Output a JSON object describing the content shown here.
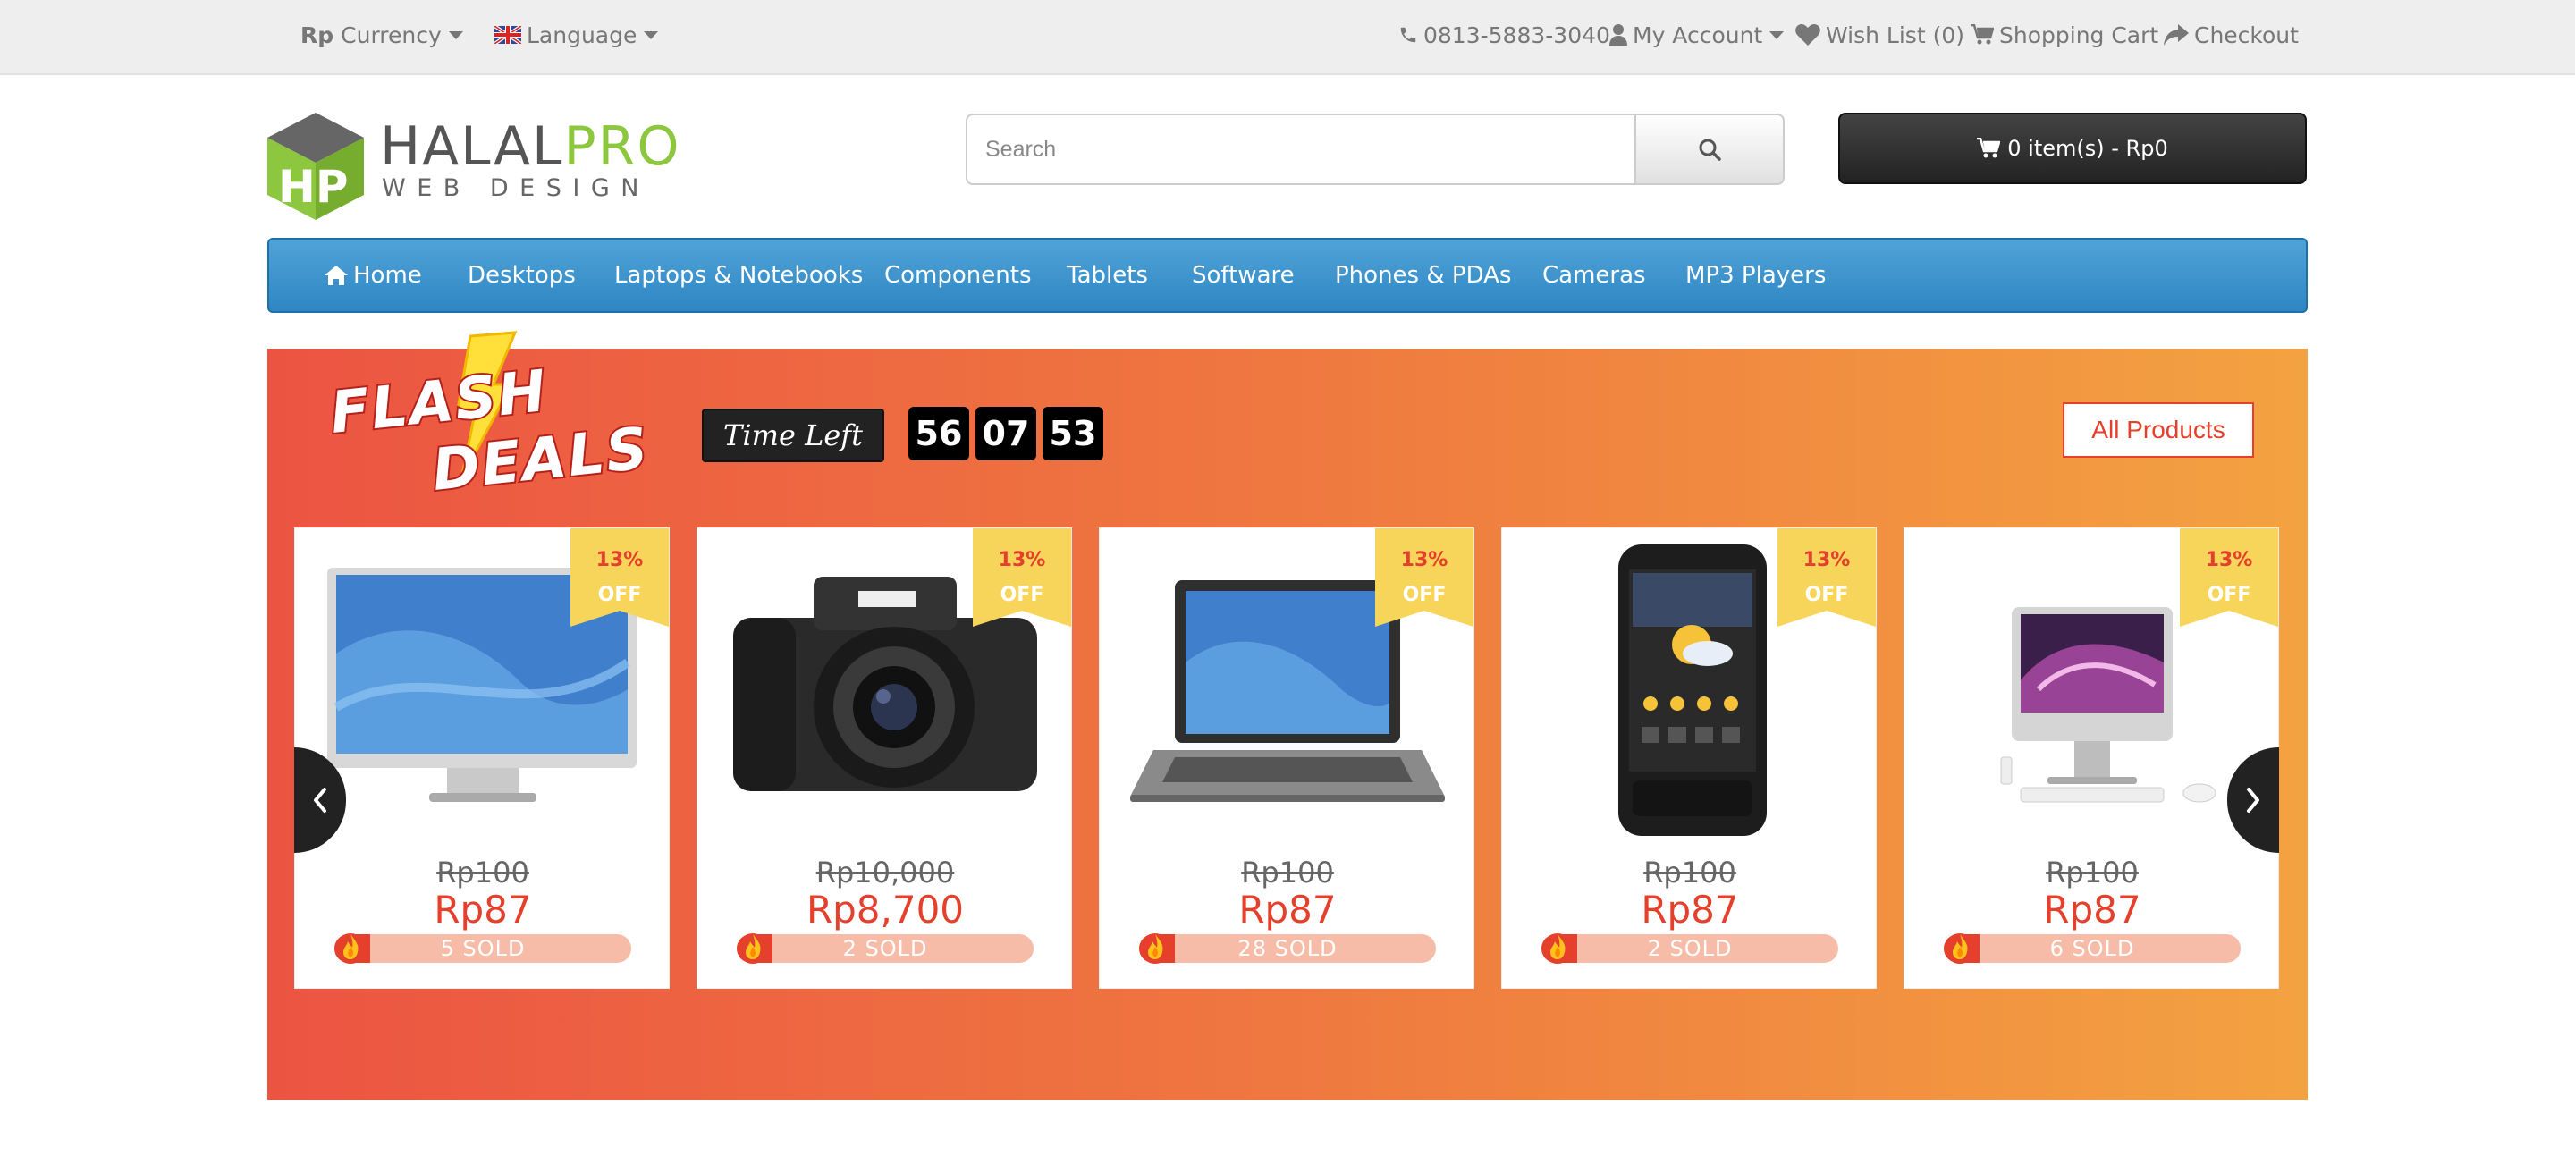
{
  "topbar": {
    "currency_symbol": "Rp",
    "currency_label": "Currency",
    "language_label": "Language",
    "phone": "0813-5883-3040",
    "account": "My Account",
    "wishlist": "Wish List (0)",
    "cart": "Shopping Cart",
    "checkout": "Checkout"
  },
  "logo": {
    "part1": "HALAL",
    "part2": "PRO",
    "tagline": "WEB DESIGN",
    "badge": "HP"
  },
  "search": {
    "placeholder": "Search"
  },
  "cart_button": {
    "label": "0 item(s) - Rp0"
  },
  "nav": {
    "items": [
      {
        "label": "Home"
      },
      {
        "label": "Desktops"
      },
      {
        "label": "Laptops & Notebooks"
      },
      {
        "label": "Components"
      },
      {
        "label": "Tablets"
      },
      {
        "label": "Software"
      },
      {
        "label": "Phones & PDAs"
      },
      {
        "label": "Cameras"
      },
      {
        "label": "MP3 Players"
      }
    ]
  },
  "flash": {
    "logo_line1": "FLASH",
    "logo_line2": "DEALS",
    "time_left_label": "Time Left",
    "countdown": [
      "56",
      "07",
      "53"
    ],
    "all_products": "All Products"
  },
  "products": [
    {
      "icon": "monitor",
      "discount": "13%",
      "off": "OFF",
      "old_price": "Rp100",
      "price": "Rp87",
      "sold": "5 SOLD",
      "sold_progress": 0.12
    },
    {
      "icon": "camera",
      "discount": "13%",
      "off": "OFF",
      "old_price": "Rp10,000",
      "price": "Rp8,700",
      "sold": "2 SOLD",
      "sold_progress": 0.12
    },
    {
      "icon": "laptop",
      "discount": "13%",
      "off": "OFF",
      "old_price": "Rp100",
      "price": "Rp87",
      "sold": "28 SOLD",
      "sold_progress": 0.12
    },
    {
      "icon": "phone",
      "discount": "13%",
      "off": "OFF",
      "old_price": "Rp100",
      "price": "Rp87",
      "sold": "2 SOLD",
      "sold_progress": 0.12
    },
    {
      "icon": "imac",
      "discount": "13%",
      "off": "OFF",
      "old_price": "Rp100",
      "price": "Rp87",
      "sold": "6 SOLD",
      "sold_progress": 0.12
    }
  ],
  "colors": {
    "accent": "#e4402c",
    "nav_blue": "#3a8fcb",
    "brand_green": "#8dc63f",
    "ribbon_yellow": "#f7d45a"
  }
}
